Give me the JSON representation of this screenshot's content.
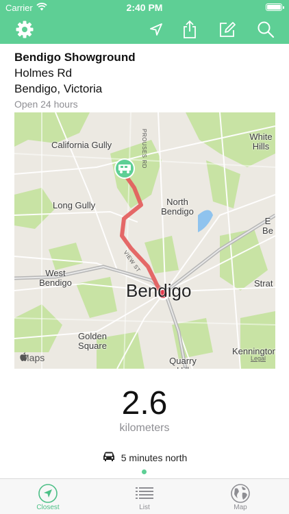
{
  "status_bar": {
    "carrier": "Carrier",
    "time": "2:40 PM"
  },
  "nav": {
    "icons": [
      "gear-icon",
      "location-arrow-icon",
      "share-icon",
      "edit-icon",
      "search-icon"
    ]
  },
  "place": {
    "name": "Bendigo Showground",
    "street": "Holmes Rd",
    "city": "Bendigo, Victoria",
    "hours": "Open 24 hours"
  },
  "map": {
    "labels": {
      "california_gully": "California Gully",
      "long_gully": "Long Gully",
      "north_bendigo": "North Bendigo",
      "west_bendigo": "West Bendigo",
      "bendigo": "Bendigo",
      "golden_square": "Golden Square",
      "quarry_hill": "Quarry Hill",
      "white_hills": "White Hills",
      "kennington": "Kennington",
      "strat": "Strat",
      "east_be": "E Be",
      "prouses_rd": "PROUSES RD",
      "view_st": "VIEW ST"
    },
    "attribution": "Maps",
    "legal": "Legal",
    "colors": {
      "route": "#e35a5a",
      "park": "#c8e3a4",
      "water": "#8fc3ee",
      "accent": "#5ecf95"
    }
  },
  "distance": {
    "value": "2.6",
    "unit": "kilometers"
  },
  "travel": {
    "text": "5 minutes north",
    "icon": "car-icon"
  },
  "tabs": [
    {
      "label": "Closest",
      "icon": "location-arrow-icon",
      "active": true
    },
    {
      "label": "List",
      "icon": "list-icon",
      "active": false
    },
    {
      "label": "Map",
      "icon": "globe-icon",
      "active": false
    }
  ]
}
